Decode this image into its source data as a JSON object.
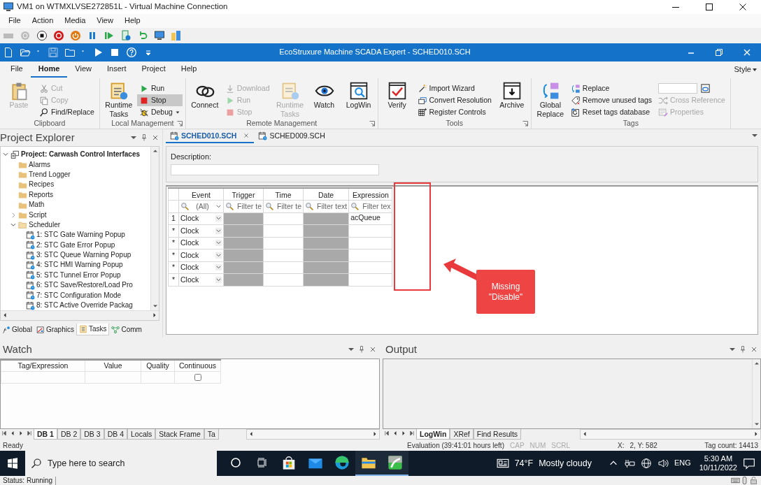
{
  "vm": {
    "title": "VM1 on WTMXLVSE272851L - Virtual Machine Connection",
    "menu": [
      "File",
      "Action",
      "Media",
      "View",
      "Help"
    ],
    "status": "Status: Running"
  },
  "app": {
    "title": "EcoStruxure Machine SCADA Expert - SCHED010.SCH"
  },
  "ribbon": {
    "tabs": [
      {
        "label": "File",
        "selected": false
      },
      {
        "label": "Home",
        "selected": true
      },
      {
        "label": "View",
        "selected": false
      },
      {
        "label": "Insert",
        "selected": false
      },
      {
        "label": "Project",
        "selected": false
      },
      {
        "label": "Help",
        "selected": false
      }
    ],
    "style_label": "Style",
    "groups": [
      {
        "name": "Clipboard",
        "launcher": false,
        "items": [
          {
            "kind": "large",
            "label": "Paste",
            "disabled": true,
            "highlighted": false
          },
          {
            "kind": "small",
            "label": "Cut",
            "disabled": true,
            "highlighted": false
          },
          {
            "kind": "small",
            "label": "Copy",
            "disabled": true,
            "highlighted": false
          },
          {
            "kind": "small",
            "label": "Find/Replace",
            "disabled": false,
            "highlighted": false
          }
        ]
      },
      {
        "name": "Local Management",
        "launcher": true,
        "items": [
          {
            "kind": "large",
            "label": "Runtime Tasks",
            "disabled": false,
            "highlighted": false
          },
          {
            "kind": "small",
            "label": "Run",
            "disabled": false,
            "highlighted": false
          },
          {
            "kind": "small",
            "label": "Stop",
            "disabled": false,
            "highlighted": true
          },
          {
            "kind": "menu",
            "label": "Debug",
            "disabled": false,
            "highlighted": false
          }
        ]
      },
      {
        "name": "Remote Management",
        "launcher": true,
        "items": [
          {
            "kind": "large",
            "label": "Connect",
            "disabled": false,
            "highlighted": false
          },
          {
            "kind": "small",
            "label": "Download",
            "disabled": true,
            "highlighted": false
          },
          {
            "kind": "small",
            "label": "Run",
            "disabled": true,
            "highlighted": false
          },
          {
            "kind": "small",
            "label": "Stop",
            "disabled": true,
            "highlighted": false
          },
          {
            "kind": "large",
            "label": "Runtime Tasks",
            "disabled": true,
            "highlighted": false
          },
          {
            "kind": "large",
            "label": "Watch",
            "disabled": false,
            "highlighted": false
          },
          {
            "kind": "large",
            "label": "LogWin",
            "disabled": false,
            "highlighted": false
          }
        ]
      },
      {
        "name": "Tools",
        "launcher": true,
        "items": [
          {
            "kind": "large",
            "label": "Verify",
            "disabled": false,
            "highlighted": false
          },
          {
            "kind": "small",
            "label": "Import Wizard",
            "disabled": false,
            "highlighted": false
          },
          {
            "kind": "small",
            "label": "Convert Resolution",
            "disabled": false,
            "highlighted": false
          },
          {
            "kind": "small",
            "label": "Register Controls",
            "disabled": false,
            "highlighted": false
          },
          {
            "kind": "large",
            "label": "Archive",
            "disabled": false,
            "highlighted": false
          }
        ]
      },
      {
        "name": "Tags",
        "launcher": false,
        "items": [
          {
            "kind": "large",
            "label": "Global Replace",
            "disabled": false,
            "highlighted": false
          },
          {
            "kind": "small",
            "label": "Replace",
            "disabled": false,
            "highlighted": false
          },
          {
            "kind": "small",
            "label": "Remove unused tags",
            "disabled": false,
            "highlighted": false
          },
          {
            "kind": "small",
            "label": "Reset tags database",
            "disabled": false,
            "highlighted": false
          },
          {
            "kind": "field",
            "disabled": false
          },
          {
            "kind": "small",
            "label": "Cross Reference",
            "disabled": true,
            "highlighted": false
          },
          {
            "kind": "small",
            "label": "Properties",
            "disabled": true,
            "highlighted": false
          }
        ]
      }
    ]
  },
  "explorer": {
    "title": "Project Explorer",
    "tree": [
      {
        "label": "Project: Carwash Control Interfaces",
        "kind": "project",
        "expanded": true,
        "children": [
          {
            "label": "Alarms",
            "kind": "folder"
          },
          {
            "label": "Trend Logger",
            "kind": "folder"
          },
          {
            "label": "Recipes",
            "kind": "folder"
          },
          {
            "label": "Reports",
            "kind": "folder"
          },
          {
            "label": "Math",
            "kind": "folder"
          },
          {
            "label": "Script",
            "kind": "folder",
            "expanded": false
          },
          {
            "label": "Scheduler",
            "kind": "folder",
            "expanded": true,
            "children": [
              {
                "label": "1: STC Gate Warning Popup",
                "kind": "schedule"
              },
              {
                "label": "2: STC Gate Error Popup",
                "kind": "schedule"
              },
              {
                "label": "3: STC Queue Warning Popup",
                "kind": "schedule"
              },
              {
                "label": "4: STC HMI Warning Popup",
                "kind": "schedule"
              },
              {
                "label": "5: STC Tunnel Error Popup",
                "kind": "schedule"
              },
              {
                "label": "6: STC Save/Restore/Load Pro",
                "kind": "schedule"
              },
              {
                "label": "7: STC Configuration Mode",
                "kind": "schedule"
              },
              {
                "label": "8: STC Active Override Packag",
                "kind": "schedule"
              }
            ]
          }
        ]
      }
    ],
    "tabs": [
      {
        "label": "Global",
        "selected": false
      },
      {
        "label": "Graphics",
        "selected": false
      },
      {
        "label": "Tasks",
        "selected": true
      },
      {
        "label": "Comm",
        "selected": false
      }
    ]
  },
  "document": {
    "tabs": [
      {
        "label": "SCHED010.SCH",
        "selected": true
      },
      {
        "label": "SCHED009.SCH",
        "selected": false
      }
    ],
    "description_label": "Description:",
    "columns": [
      {
        "label": "Event",
        "disabled": false
      },
      {
        "label": "Trigger",
        "disabled": true
      },
      {
        "label": "Time",
        "disabled": false
      },
      {
        "label": "Date",
        "disabled": true
      },
      {
        "label": "Expression",
        "disabled": false
      }
    ],
    "filters": [
      {
        "kind": "dropdown",
        "text": "(All)"
      },
      {
        "kind": "text",
        "text": "Filter te"
      },
      {
        "kind": "text",
        "text": "Filter te"
      },
      {
        "kind": "text",
        "text": "Filter text"
      },
      {
        "kind": "text",
        "text": "Filter tex"
      }
    ],
    "rows": [
      {
        "marker": "1",
        "event": "Clock",
        "expression": "acQueue"
      },
      {
        "marker": "*",
        "event": "Clock"
      },
      {
        "marker": "*",
        "event": "Clock"
      },
      {
        "marker": "*",
        "event": "Clock"
      },
      {
        "marker": "*",
        "event": "Clock"
      },
      {
        "marker": "*",
        "event": "Clock"
      }
    ]
  },
  "annotation": {
    "text": "Missing \"Disable\""
  },
  "watch": {
    "title": "Watch",
    "columns": [
      "Tag/Expression",
      "Value",
      "Quality",
      "Continuous"
    ],
    "rows": [
      {
        "continuous": false
      }
    ],
    "tabs": [
      {
        "label": "DB 1",
        "selected": true
      },
      {
        "label": "DB 2",
        "selected": false
      },
      {
        "label": "DB 3",
        "selected": false
      },
      {
        "label": "DB 4",
        "selected": false
      },
      {
        "label": "Locals",
        "selected": false
      },
      {
        "label": "Stack Frame",
        "selected": false
      },
      {
        "label": "Ta",
        "selected": false
      }
    ]
  },
  "output": {
    "title": "Output",
    "tabs": [
      {
        "label": "LogWin",
        "selected": true
      },
      {
        "label": "XRef",
        "selected": false
      },
      {
        "label": "Find Results",
        "selected": false
      }
    ]
  },
  "status_bar": {
    "ready": "Ready",
    "evaluation": "Evaluation (39:41:01 hours left)",
    "keys": [
      {
        "label": "CAP",
        "on": false
      },
      {
        "label": "NUM",
        "on": false
      },
      {
        "label": "SCRL",
        "on": false
      }
    ],
    "x_label": "X:",
    "coords": "2, Y:  582",
    "tag_count": "Tag count: 14413"
  },
  "taskbar": {
    "search_placeholder": "Type here to search",
    "apps": [
      {
        "open": false
      },
      {
        "open": false
      },
      {
        "open": false
      },
      {
        "open": true
      },
      {
        "open": true
      }
    ],
    "temperature": "74°F",
    "weather": "Mostly cloudy",
    "language": "ENG",
    "time": "5:30 AM",
    "date": "10/11/2022"
  }
}
